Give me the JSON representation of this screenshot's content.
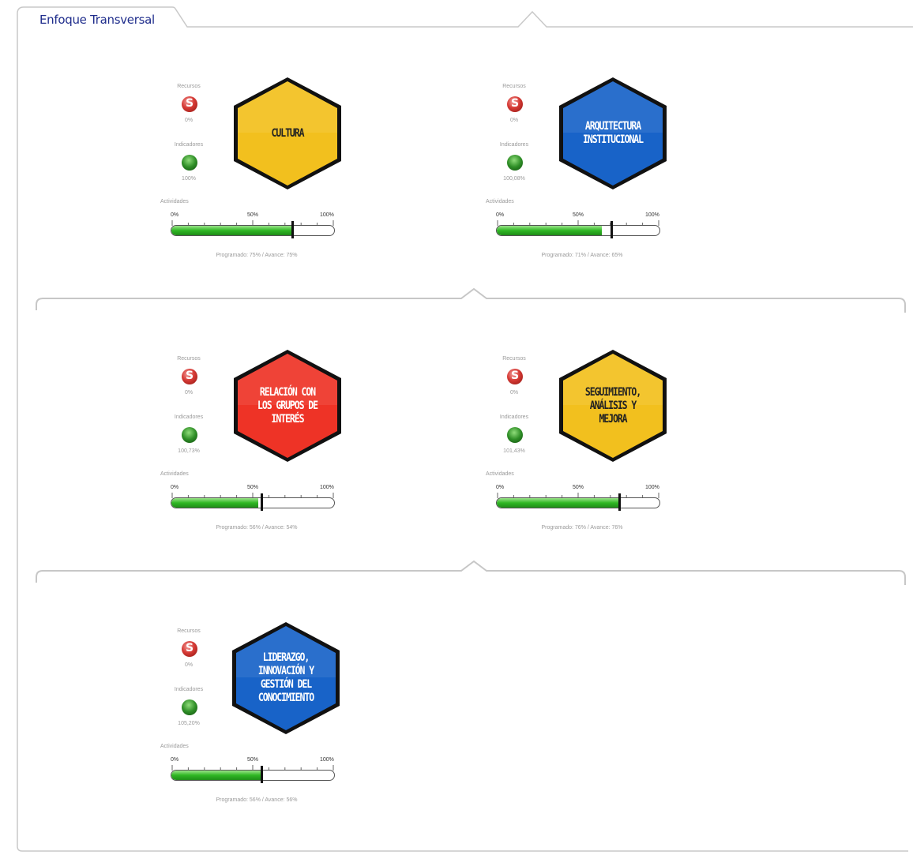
{
  "tab": {
    "label": "Enfoque Transversal"
  },
  "labels": {
    "recursos": "Recursos",
    "indicadores": "Indicadores",
    "actividades": "Actividades",
    "scale0": "0%",
    "scale50": "50%",
    "scale100": "100%"
  },
  "cards": [
    {
      "title": "CULTURA",
      "recursos": "0%",
      "indicadores": "100%",
      "programado": 75,
      "avance": 75,
      "footer": "Programado: 75% / Avance: 75%",
      "color": "#f2c01e",
      "text_color": "#222222"
    },
    {
      "title": "ARQUITECTURA INSTITUCIONAL",
      "recursos": "0%",
      "indicadores": "100,08%",
      "programado": 71,
      "avance": 65,
      "footer": "Programado: 71% / Avance: 65%",
      "color": "#1863c8",
      "text_color": "#ffffff"
    },
    {
      "title": "RELACIÓN CON LOS GRUPOS DE INTERÉS",
      "recursos": "0%",
      "indicadores": "100,73%",
      "programado": 56,
      "avance": 54,
      "footer": "Programado: 56% / Avance: 54%",
      "color": "#ee3326",
      "text_color": "#ffffff"
    },
    {
      "title": "SEGUIMIENTO, ANÁLISIS Y MEJORA",
      "recursos": "0%",
      "indicadores": "101,43%",
      "programado": 76,
      "avance": 76,
      "footer": "Programado: 76% / Avance: 76%",
      "color": "#f2c01e",
      "text_color": "#222222"
    },
    {
      "title": "LIDERAZGO, INNOVACIÓN Y GESTIÓN DEL CONOCIMIENTO",
      "recursos": "0%",
      "indicadores": "105,20%",
      "programado": 56,
      "avance": 56,
      "footer": "Programado: 56% / Avance: 56%",
      "color": "#1863c8",
      "text_color": "#ffffff"
    }
  ]
}
